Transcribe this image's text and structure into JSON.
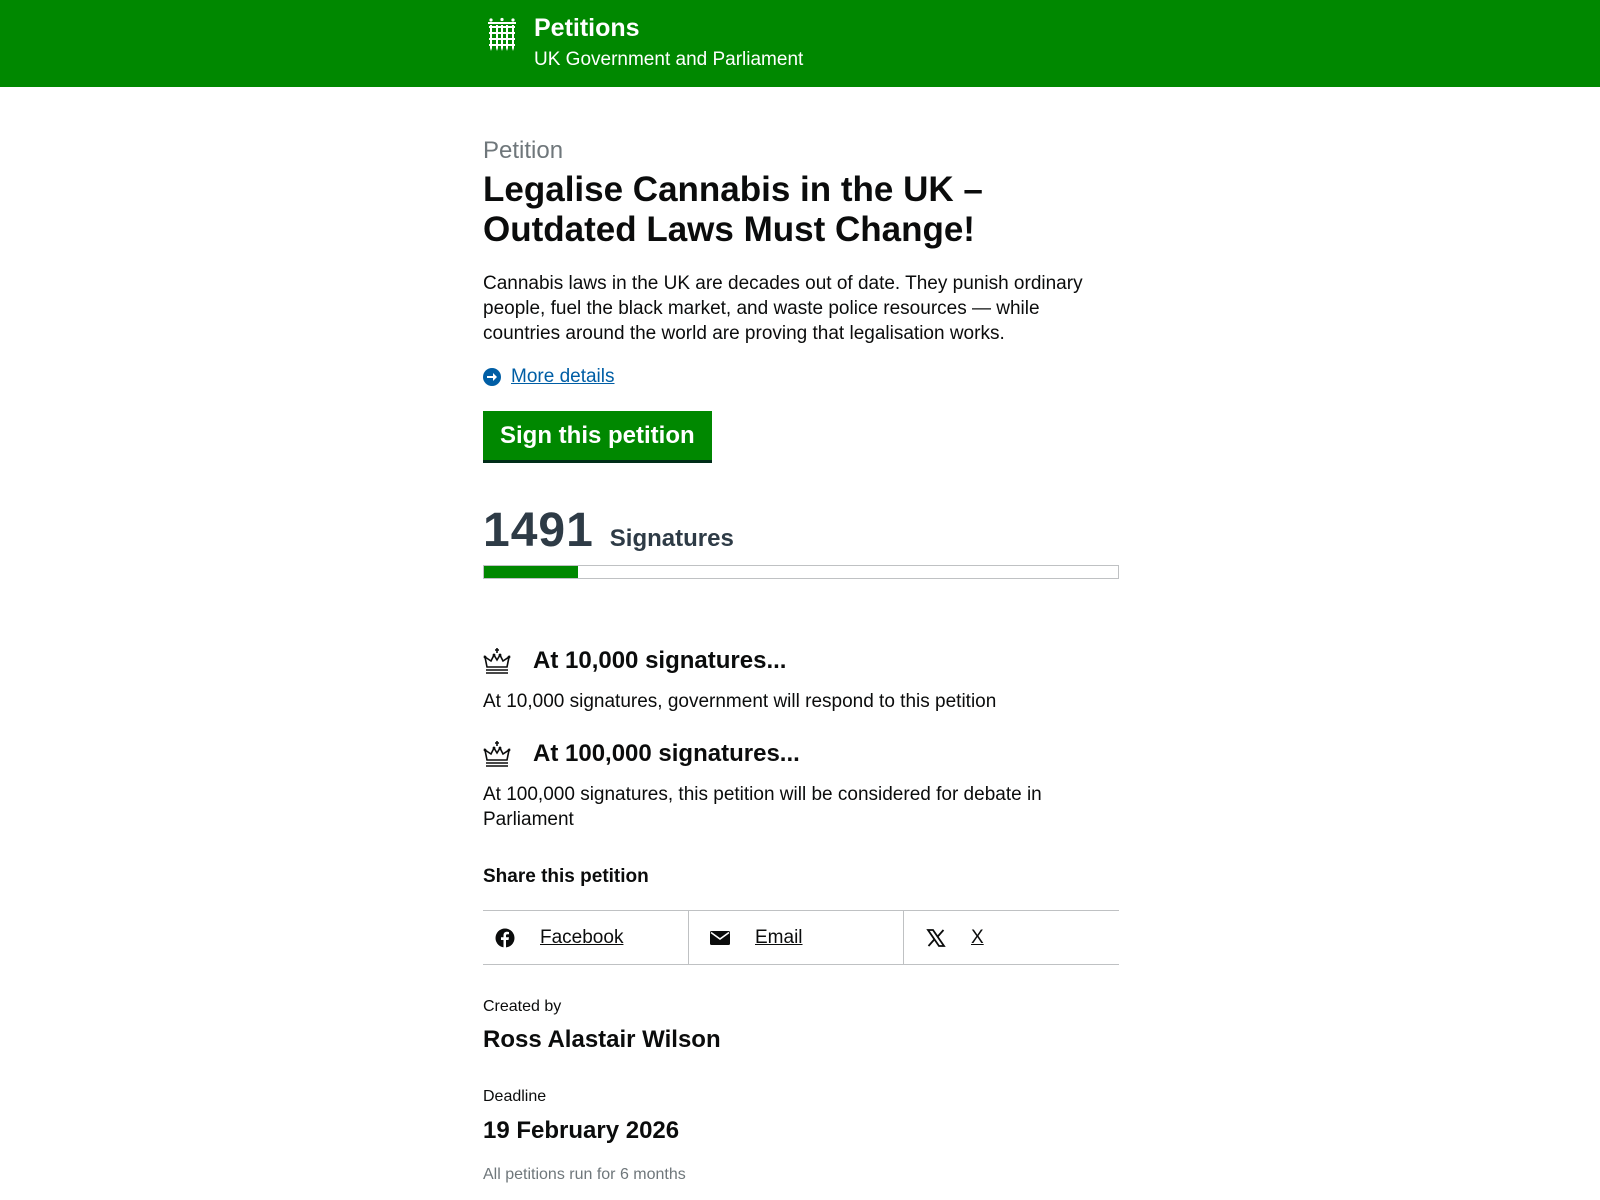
{
  "header": {
    "title": "Petitions",
    "subtitle": "UK Government and Parliament",
    "logo_icon": "portcullis-icon",
    "background": "#008800"
  },
  "petition": {
    "caption": "Petition",
    "title": "Legalise Cannabis in the UK – Outdated Laws Must Change!",
    "summary": "Cannabis laws in the UK are decades out of date. They punish ordinary people, fuel the black market, and waste police resources — while countries around the world are proving that legalisation works.",
    "more_details": "More details",
    "sign_button": "Sign this petition"
  },
  "signatures": {
    "count": "1491",
    "label": "Signatures",
    "progress_fraction": 0.149
  },
  "thresholds": [
    {
      "icon": "crown-icon",
      "title": "At 10,000 signatures...",
      "text": "At 10,000 signatures, government will respond to this petition"
    },
    {
      "icon": "crown-icon",
      "title": "At 100,000 signatures...",
      "text": "At 100,000 signatures, this petition will be considered for debate in Parliament"
    }
  ],
  "share": {
    "title": "Share this petition",
    "items": [
      {
        "label": "Facebook",
        "icon": "facebook-icon"
      },
      {
        "label": "Email",
        "icon": "envelope-icon"
      },
      {
        "label": "X",
        "icon": "x-icon"
      }
    ]
  },
  "created": {
    "label": "Created by",
    "value": "Ross Alastair Wilson"
  },
  "deadline": {
    "label": "Deadline",
    "value": "19 February 2026",
    "note": "All petitions run for 6 months"
  },
  "colors": {
    "brand_green": "#008800",
    "link_blue": "#005ea5",
    "text": "#0b0c0c",
    "muted": "#6f777b"
  }
}
